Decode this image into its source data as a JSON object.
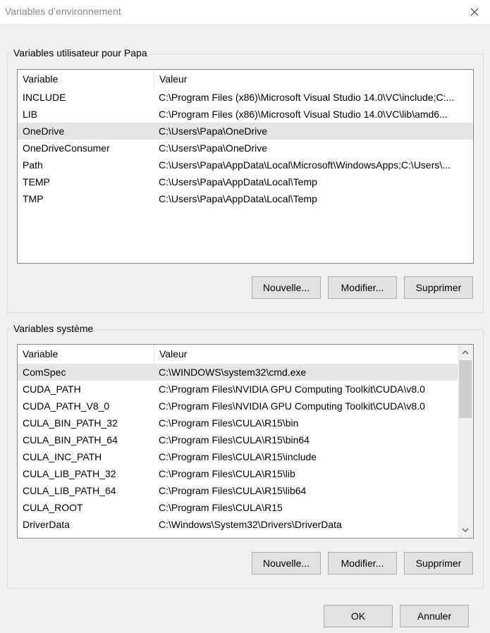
{
  "window": {
    "title": "Variables d’environnement"
  },
  "user_group": {
    "label": "Variables utilisateur pour Papa",
    "columns": [
      "Variable",
      "Valeur"
    ],
    "rows": [
      {
        "variable": "INCLUDE",
        "value": "C:\\Program Files (x86)\\Microsoft Visual Studio 14.0\\VC\\include;C:..."
      },
      {
        "variable": "LIB",
        "value": "C:\\Program Files (x86)\\Microsoft Visual Studio 14.0\\VC\\lib\\amd6..."
      },
      {
        "variable": "OneDrive",
        "value": "C:\\Users\\Papa\\OneDrive"
      },
      {
        "variable": "OneDriveConsumer",
        "value": "C:\\Users\\Papa\\OneDrive"
      },
      {
        "variable": "Path",
        "value": "C:\\Users\\Papa\\AppData\\Local\\Microsoft\\WindowsApps;C:\\Users\\..."
      },
      {
        "variable": "TEMP",
        "value": "C:\\Users\\Papa\\AppData\\Local\\Temp"
      },
      {
        "variable": "TMP",
        "value": "C:\\Users\\Papa\\AppData\\Local\\Temp"
      }
    ],
    "selected_index": 2,
    "buttons": {
      "new": "Nouvelle...",
      "edit": "Modifier...",
      "delete": "Supprimer"
    }
  },
  "system_group": {
    "label": "Variables système",
    "columns": [
      "Variable",
      "Valeur"
    ],
    "rows": [
      {
        "variable": "ComSpec",
        "value": "C:\\WINDOWS\\system32\\cmd.exe"
      },
      {
        "variable": "CUDA_PATH",
        "value": "C:\\Program Files\\NVIDIA GPU Computing Toolkit\\CUDA\\v8.0"
      },
      {
        "variable": "CUDA_PATH_V8_0",
        "value": "C:\\Program Files\\NVIDIA GPU Computing Toolkit\\CUDA\\v8.0"
      },
      {
        "variable": "CULA_BIN_PATH_32",
        "value": "C:\\Program Files\\CULA\\R15\\bin"
      },
      {
        "variable": "CULA_BIN_PATH_64",
        "value": "C:\\Program Files\\CULA\\R15\\bin64"
      },
      {
        "variable": "CULA_INC_PATH",
        "value": "C:\\Program Files\\CULA\\R15\\include"
      },
      {
        "variable": "CULA_LIB_PATH_32",
        "value": "C:\\Program Files\\CULA\\R15\\lib"
      },
      {
        "variable": "CULA_LIB_PATH_64",
        "value": "C:\\Program Files\\CULA\\R15\\lib64"
      },
      {
        "variable": "CULA_ROOT",
        "value": "C:\\Program Files\\CULA\\R15"
      },
      {
        "variable": "DriverData",
        "value": "C:\\Windows\\System32\\Drivers\\DriverData"
      }
    ],
    "selected_index": 0,
    "buttons": {
      "new": "Nouvelle...",
      "edit": "Modifier...",
      "delete": "Supprimer"
    }
  },
  "dialog_buttons": {
    "ok": "OK",
    "cancel": "Annuler"
  },
  "icons": {
    "close": "close-icon",
    "scroll_up": "chevron-up-icon",
    "scroll_down": "chevron-down-icon"
  },
  "colors": {
    "selection": "#e5e5e5",
    "button_face": "#e1e1e1",
    "button_border": "#adadad",
    "dialog_bg": "#f0f0f0"
  }
}
